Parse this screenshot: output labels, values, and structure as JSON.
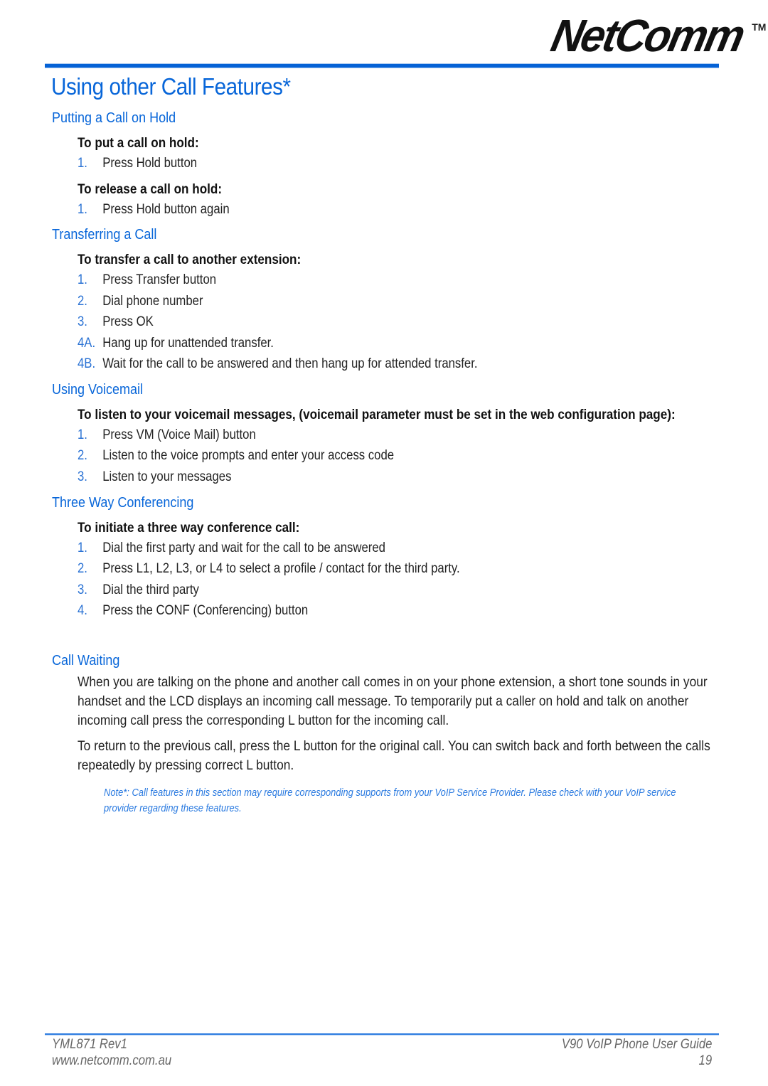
{
  "header": {
    "logo_text": "NetComm",
    "logo_tm": "TM",
    "accent_color": "#0866d9"
  },
  "page_title": "Using other Call Features*",
  "sections": {
    "hold": {
      "heading": "Putting a Call on Hold",
      "put_lead": "To put a call on hold:",
      "put_steps": [
        {
          "num": "1.",
          "text": "Press Hold button"
        }
      ],
      "release_lead": "To release a call on hold:",
      "release_steps": [
        {
          "num": "1.",
          "text": "Press Hold button again"
        }
      ]
    },
    "transfer": {
      "heading": "Transferring a Call",
      "lead": "To transfer a call to another extension:",
      "steps": [
        {
          "num": "1.",
          "text": "Press Transfer button"
        },
        {
          "num": "2.",
          "text": "Dial phone number"
        },
        {
          "num": "3.",
          "text": "Press OK"
        },
        {
          "num": "4A.",
          "text": "Hang up for unattended transfer."
        },
        {
          "num": "4B.",
          "text": "Wait for the call to be answered and then hang up for attended transfer."
        }
      ]
    },
    "voicemail": {
      "heading": "Using Voicemail",
      "lead": "To listen to your voicemail messages, (voicemail parameter must be set in the web configuration page):",
      "steps": [
        {
          "num": "1.",
          "text": "Press VM (Voice Mail) button"
        },
        {
          "num": "2.",
          "text": "Listen to the voice prompts and enter your access code"
        },
        {
          "num": "3.",
          "text": "Listen to your messages"
        }
      ]
    },
    "conference": {
      "heading": "Three Way Conferencing",
      "lead": "To initiate a three way conference call:",
      "steps": [
        {
          "num": "1.",
          "text": "Dial the first party and wait for the call to be answered"
        },
        {
          "num": "2.",
          "text": "Press L1, L2, L3, or L4 to select a profile / contact for the third party."
        },
        {
          "num": "3.",
          "text": "Dial the third party"
        },
        {
          "num": "4.",
          "text": "Press the CONF (Conferencing) button"
        }
      ]
    },
    "call_waiting": {
      "heading": "Call Waiting",
      "paragraphs": [
        "When you are talking on the phone and another call comes in on your phone extension, a short tone sounds in your handset and the LCD displays an incoming call message. To temporarily put a caller on hold and talk on another incoming call press the corresponding L button for the incoming call.",
        "To return to the previous call, press the L button for the original call. You can switch back and forth between the calls repeatedly by pressing correct L button."
      ],
      "note": "Note*: Call features in this section may require corresponding supports from your VoIP Service Provider. Please check with your VoIP service provider regarding these features."
    }
  },
  "footer": {
    "doc_code": "YML871 Rev1",
    "website": "www.netcomm.com.au",
    "guide_title": "V90 VoIP Phone User Guide",
    "page_number": "19"
  }
}
